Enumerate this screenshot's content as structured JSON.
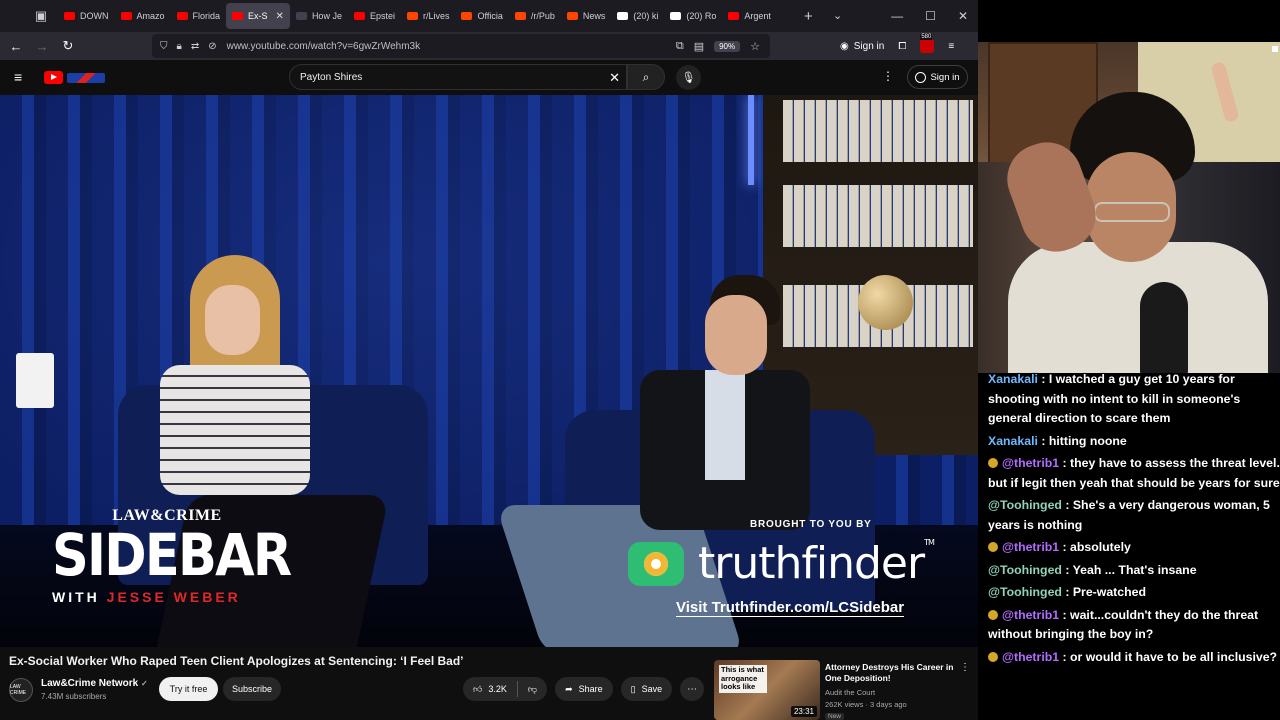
{
  "tabs": [
    {
      "label": "DOWN",
      "color": "#ff0000",
      "active": false
    },
    {
      "label": "Amazo",
      "color": "#ff0000",
      "active": false
    },
    {
      "label": "Florida",
      "color": "#ff0000",
      "active": false
    },
    {
      "label": "Ex-S",
      "color": "#ff0000",
      "active": true
    },
    {
      "label": "How Je",
      "color": "#42414d",
      "active": false
    },
    {
      "label": "Epstei",
      "color": "#ff0000",
      "active": false
    },
    {
      "label": "r/Lives",
      "color": "#ff4500",
      "active": false
    },
    {
      "label": "Officia",
      "color": "#ff4500",
      "active": false
    },
    {
      "label": "/r/Pub",
      "color": "#ff4500",
      "active": false
    },
    {
      "label": "News",
      "color": "#ff4500",
      "active": false
    },
    {
      "label": "(20) ki",
      "color": "#ffffff",
      "active": false
    },
    {
      "label": "(20) Ro",
      "color": "#ffffff",
      "active": false
    },
    {
      "label": "Argent",
      "color": "#ff0000",
      "active": false
    }
  ],
  "url": "www.youtube.com/watch?v=6gwZrWehm3k",
  "zoom": "90%",
  "browser_signin": "Sign in",
  "ext_badge_count": "580",
  "yt": {
    "search_value": "Payton Shires",
    "signin": "Sign in"
  },
  "video": {
    "brand_top": "LAW&CRIME",
    "brand_main": "SIDEBAR",
    "brand_sub_with": "WITH",
    "brand_sub_name": "JESSE WEBER",
    "sponsor_top": "BROUGHT TO YOU BY",
    "sponsor_name": "truthfinder",
    "sponsor_tm": "TM",
    "sponsor_url": "Visit Truthfinder.com/LCSidebar",
    "mug_text": ""
  },
  "title": "Ex-Social Worker Who Raped Teen Client Apologizes at Sentencing: ‘I Feel Bad’",
  "channel": {
    "avatar_text": "LAW CRIME",
    "name": "Law&Crime Network",
    "verified": "✓",
    "subs": "7.43M subscribers",
    "try_label": "Try it free",
    "subscribe_label": "Subscribe"
  },
  "actions": {
    "likes": "3.2K",
    "share": "Share",
    "save": "Save"
  },
  "recommendation": {
    "thumb_text": "This is what arrogance looks like",
    "duration": "23:31",
    "title": "Attorney Destroys His Career in One Deposition!",
    "channel": "Audit the Court",
    "meta": "262K views · 3 days ago",
    "badge": "New"
  },
  "chat": [
    {
      "user": "Xanakali",
      "text": "I watched a guy get 10 years for shooting with no intent to kill in someone's general direction to scare them",
      "style": "blue",
      "badge": false
    },
    {
      "user": "Xanakali",
      "text": "hitting noone",
      "style": "blue",
      "badge": false
    },
    {
      "user": "@thetrib1",
      "text": "they have to assess the threat level. but if legit then yeah that should be years for sure",
      "style": "purple",
      "badge": true
    },
    {
      "user": "@Toohinged",
      "text": "She's a very dangerous woman, 5 years is nothing",
      "style": "teal",
      "badge": false
    },
    {
      "user": "@thetrib1",
      "text": "absolutely",
      "style": "purple",
      "badge": true
    },
    {
      "user": "@Toohinged",
      "text": "Yeah ... That's insane",
      "style": "teal",
      "badge": false
    },
    {
      "user": "@Toohinged",
      "text": "Pre-watched",
      "style": "teal",
      "badge": false
    },
    {
      "user": "@thetrib1",
      "text": "wait...couldn't they do the threat without bringing the boy in?",
      "style": "purple",
      "badge": true
    },
    {
      "user": "@thetrib1",
      "text": "or would it have to be all inclusive?",
      "style": "purple",
      "badge": true
    }
  ]
}
